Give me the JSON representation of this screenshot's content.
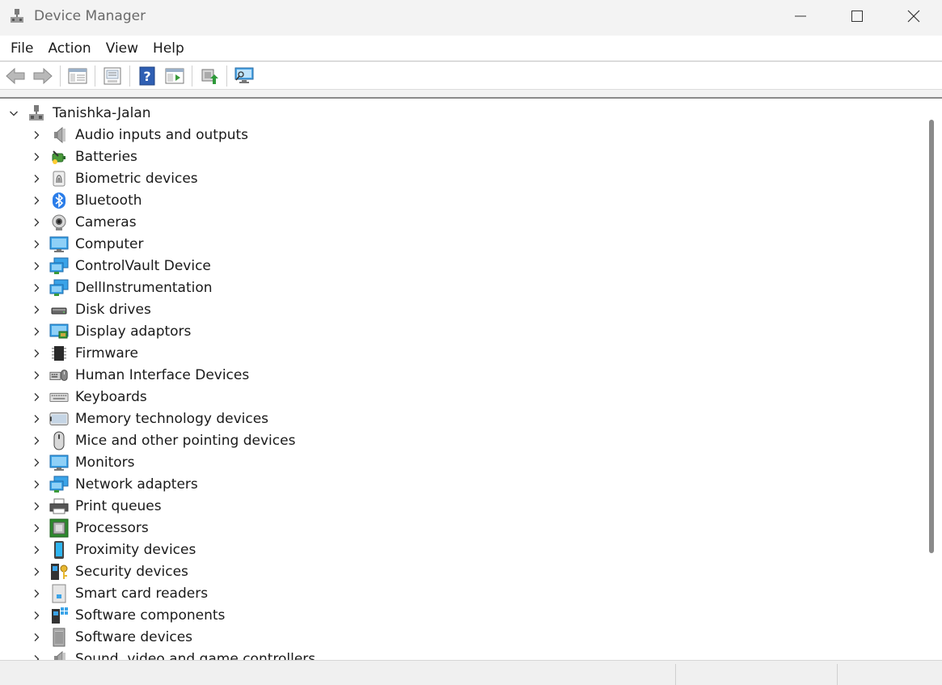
{
  "window": {
    "title": "Device Manager"
  },
  "menu": {
    "items": [
      "File",
      "Action",
      "View",
      "Help"
    ]
  },
  "toolbar": {
    "buttons": [
      "back-arrow-icon",
      "forward-arrow-icon",
      "show-hide-console-tree-icon",
      "properties-icon",
      "help-icon",
      "run-icon",
      "update-driver-icon",
      "scan-hardware-icon"
    ]
  },
  "tree": {
    "root": "Tanishka-Jalan",
    "categories": [
      {
        "label": "Audio inputs and outputs",
        "icon": "speaker-icon"
      },
      {
        "label": "Batteries",
        "icon": "battery-icon"
      },
      {
        "label": "Biometric devices",
        "icon": "fingerprint-icon"
      },
      {
        "label": "Bluetooth",
        "icon": "bluetooth-icon"
      },
      {
        "label": "Cameras",
        "icon": "camera-icon"
      },
      {
        "label": "Computer",
        "icon": "computer-monitor-icon"
      },
      {
        "label": "ControlVault Device",
        "icon": "network-monitor-icon"
      },
      {
        "label": "DellInstrumentation",
        "icon": "network-monitor-icon"
      },
      {
        "label": "Disk drives",
        "icon": "disk-drive-icon"
      },
      {
        "label": "Display adaptors",
        "icon": "display-adapter-icon"
      },
      {
        "label": "Firmware",
        "icon": "firmware-chip-icon"
      },
      {
        "label": "Human Interface Devices",
        "icon": "hid-icon"
      },
      {
        "label": "Keyboards",
        "icon": "keyboard-icon"
      },
      {
        "label": "Memory technology devices",
        "icon": "memory-icon"
      },
      {
        "label": "Mice and other pointing devices",
        "icon": "mouse-icon"
      },
      {
        "label": "Monitors",
        "icon": "monitor-icon"
      },
      {
        "label": "Network adapters",
        "icon": "network-monitor-icon"
      },
      {
        "label": "Print queues",
        "icon": "printer-icon"
      },
      {
        "label": "Processors",
        "icon": "processor-icon"
      },
      {
        "label": "Proximity devices",
        "icon": "proximity-icon"
      },
      {
        "label": "Security devices",
        "icon": "security-key-icon"
      },
      {
        "label": "Smart card readers",
        "icon": "smart-card-icon"
      },
      {
        "label": "Software components",
        "icon": "software-component-icon"
      },
      {
        "label": "Software devices",
        "icon": "software-device-icon"
      },
      {
        "label": "Sound, video and game controllers",
        "icon": "speaker-icon"
      }
    ]
  },
  "colors": {
    "accent_blue": "#2b7de9",
    "monitor_blue": "#3aa3e8",
    "green": "#3a9a3a"
  }
}
